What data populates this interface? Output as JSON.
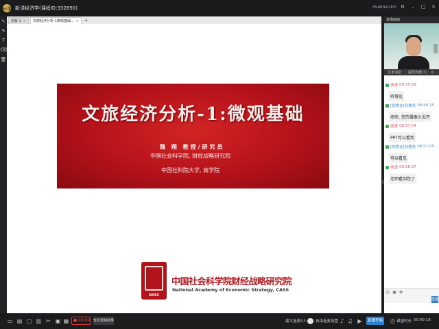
{
  "window": {
    "title": "新漳经济学(课程ID:332890)",
    "user": "dvoknsn1m",
    "app_logo": "云课"
  },
  "left_tools": [
    "cursor-icon",
    "pen-icon",
    "text-icon",
    "eraser-icon",
    "trash-icon"
  ],
  "tabs": [
    {
      "label": "白板 1",
      "active": false
    },
    {
      "label": "文旅经济分析-1微观基础...",
      "active": true
    }
  ],
  "tab_add": "+",
  "slide": {
    "title": "文旅经济分析-1:微观基础",
    "author": "魏 翔 教授/研究员",
    "affiliation_1": "中国社会科学院, 财经战略研究院",
    "affiliation_2": "中国社科院大学, 商学院",
    "logo_seal_text": "NAES",
    "logo_cn": "中国社会科学院财经战略研究院",
    "logo_en": "National Academy of Economic Strategy, CASS",
    "banner_color": "#b4121a"
  },
  "right_panel": {
    "header": "直播画面",
    "tabs": [
      "文本消息",
      "成员列表(7)"
    ],
    "messages": [
      {
        "role_color": "#3fae5c",
        "name": "渠潇",
        "time": "08:55:59",
        "text": "听得见",
        "name_color": "#e45b5b"
      },
      {
        "role_color": "#3fae5c",
        "name": "[助教]社科教务",
        "time": "08:56:25",
        "text": "老师, 您的摄像头没开",
        "name_color": "#4a8fd6"
      },
      {
        "role_color": "#3fae5c",
        "name": "渠潇",
        "time": "08:57:04",
        "text": "PPT可以看到",
        "name_color": "#e45b5b"
      },
      {
        "role_color": "#3fae5c",
        "name": "[助教]社科教务",
        "time": "08:57:05",
        "text": "可以看见",
        "name_color": "#4a8fd6"
      },
      {
        "role_color": "#3fae5c",
        "name": "渠潇",
        "time": "08:58:07",
        "text": "老师看到您了",
        "name_color": "#e45b5b"
      }
    ],
    "send_label": "发送"
  },
  "bottom": {
    "record_label": "00:00",
    "stop_record_label": "暂定录制结果",
    "max_seats": "最大连麦5人",
    "auto_mic": "自由连麦设置",
    "start_label": "直播开始",
    "elapsed_label": "课堂时长",
    "elapsed": "00:00:18"
  }
}
